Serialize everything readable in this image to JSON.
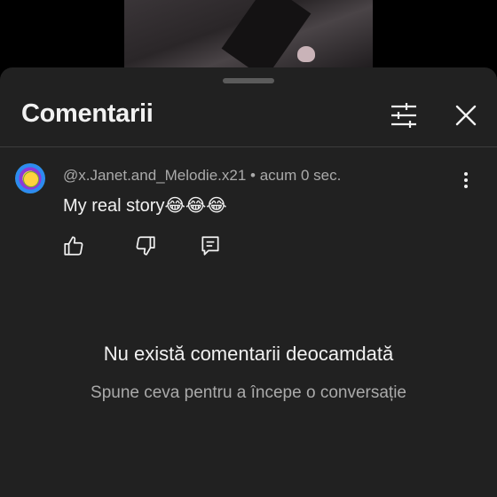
{
  "header": {
    "title": "Comentarii"
  },
  "comment": {
    "author": "@x.Janet.and_Melodie.x21",
    "separator": "•",
    "time": "acum 0 sec.",
    "text": "My real story😂😂😂"
  },
  "empty_state": {
    "title": "Nu există comentarii deocamdată",
    "subtitle": "Spune ceva pentru a începe o conversație"
  }
}
